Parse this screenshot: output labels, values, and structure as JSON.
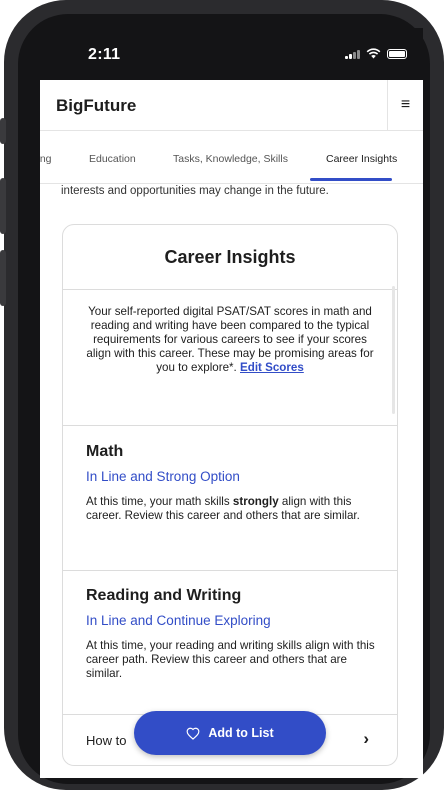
{
  "status_bar": {
    "time": "2:11"
  },
  "header": {
    "brand": "BigFuture",
    "menu_glyph": "≡"
  },
  "tabs": [
    {
      "label": "ring",
      "active": false
    },
    {
      "label": "Education",
      "active": false
    },
    {
      "label": "Tasks, Knowledge, Skills",
      "active": false
    },
    {
      "label": "Career Insights",
      "active": true
    }
  ],
  "intro_text": "interests and opportunities may change in the future.",
  "card": {
    "title": "Career Insights",
    "description": "Your self-reported digital PSAT/SAT scores in math and reading and writing have been compared to the typical requirements for various careers to see if your scores align with this career. These may be promising areas for you to explore*.",
    "edit_link": "Edit Scores",
    "sections": [
      {
        "title": "Math",
        "subtitle": "In Line and Strong Option",
        "body_before": "At this time, your math skills ",
        "body_emphasis": "strongly",
        "body_after": " align with this career. Review this career and others that are similar."
      },
      {
        "title": "Reading and Writing",
        "subtitle": "In Line and Continue Exploring",
        "body": "At this time, your reading and writing skills align with this career path. Review this career and others that are similar."
      }
    ],
    "footer_row": {
      "label": "How to",
      "chevron": "›"
    }
  },
  "add_button": {
    "label": "Add to List",
    "icon": "heart-outline-icon"
  },
  "colors": {
    "accent": "#324dc7",
    "phone_frame": "#2b2b2e",
    "text": "#1e1e1e"
  }
}
